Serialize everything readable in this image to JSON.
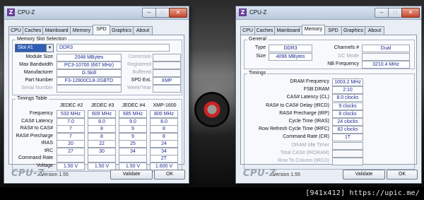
{
  "footer": "[941x412] https://upic.me/",
  "left": {
    "app_icon": "Z",
    "title": "CPU-Z",
    "tabs": [
      "CPU",
      "Caches",
      "Mainboard",
      "Memory",
      "SPD",
      "Graphics",
      "About"
    ],
    "active_tab": "SPD",
    "slot_group_title": "Memory Slot Selection",
    "slot_select": "Slot #1",
    "memory_type": "DDR3",
    "rows": [
      {
        "label": "Module Size",
        "value": "2048 MBytes",
        "right_label": "Correction",
        "right_value": ""
      },
      {
        "label": "Max Bandwidth",
        "value": "PC3-10700 (667 MHz)",
        "right_label": "Registered",
        "right_value": ""
      },
      {
        "label": "Manufacturer",
        "value": "G.Skill",
        "right_label": "Buffered",
        "right_value": ""
      },
      {
        "label": "Part Number",
        "value": "F3-12800CL8-2GBTD",
        "right_label": "SPD Ext.",
        "right_value": "XMP"
      },
      {
        "label": "Serial Number",
        "value": "",
        "right_label": "Week/Year",
        "right_value": ""
      }
    ],
    "timings_group_title": "Timings Table",
    "timings_headers": [
      "JEDEC #2",
      "JEDEC #3",
      "JEDEC #4",
      "XMP-1600"
    ],
    "timings_rows": [
      {
        "label": "Frequency",
        "values": [
          "533 MHz",
          "609 MHz",
          "685 MHz",
          "800 MHz"
        ]
      },
      {
        "label": "CAS# Latency",
        "values": [
          "7.0",
          "8.0",
          "9.0",
          "8.0"
        ]
      },
      {
        "label": "RAS# to CAS#",
        "values": [
          "7",
          "8",
          "9",
          "8"
        ]
      },
      {
        "label": "RAS# Precharge",
        "values": [
          "7",
          "8",
          "9",
          "8"
        ]
      },
      {
        "label": "tRAS",
        "values": [
          "20",
          "22",
          "25",
          "24"
        ]
      },
      {
        "label": "tRC",
        "values": [
          "27",
          "30",
          "34",
          "34"
        ]
      },
      {
        "label": "Command Rate",
        "values": [
          "",
          "",
          "",
          "2T"
        ]
      },
      {
        "label": "Voltage",
        "values": [
          "1.50 V",
          "1.50 V",
          "1.50 V",
          "1.600 V"
        ]
      }
    ],
    "brand": "CPU-Z",
    "version": "Version 1.55",
    "validate_label": "Validate",
    "ok_label": "OK"
  },
  "right": {
    "app_icon": "Z",
    "title": "CPU-Z",
    "tabs": [
      "CPU",
      "Caches",
      "Mainboard",
      "Memory",
      "SPD",
      "Graphics",
      "About"
    ],
    "active_tab": "Memory",
    "general_title": "General",
    "type_label": "Type",
    "type_value": "DDR3",
    "size_label": "Size",
    "size_value": "4096 MBytes",
    "channels_label": "Channels #",
    "channels_value": "Dual",
    "dc_mode_label": "DC Mode",
    "dc_mode_value": "",
    "nb_freq_label": "NB Frequency",
    "nb_freq_value": "3210.4 MHz",
    "timings_title": "Timings",
    "timings": [
      {
        "label": "DRAM Frequency",
        "value": "1003.2 MHz",
        "grey": false
      },
      {
        "label": "FSB:DRAM",
        "value": "2:10",
        "grey": false
      },
      {
        "label": "CAS# Latency (CL)",
        "value": "8.0 clocks",
        "grey": false
      },
      {
        "label": "RAS# to CAS# Delay (tRCD)",
        "value": "9 clocks",
        "grey": false
      },
      {
        "label": "RAS# Precharge (tRP)",
        "value": "8 clocks",
        "grey": false
      },
      {
        "label": "Cycle Time (tRAS)",
        "value": "24 clocks",
        "grey": false
      },
      {
        "label": "Row Refresh Cycle Time (tRFC)",
        "value": "82 clocks",
        "grey": false
      },
      {
        "label": "Command Rate (CR)",
        "value": "1T",
        "grey": false
      },
      {
        "label": "DRAM Idle Timer",
        "value": "",
        "grey": true
      },
      {
        "label": "Total CAS# (tRDRAM)",
        "value": "",
        "grey": true
      },
      {
        "label": "Row To Column (tRCD)",
        "value": "",
        "grey": true
      }
    ],
    "brand": "CPU-Z",
    "version": "Version 1.55",
    "validate_label": "Validate",
    "ok_label": "OK"
  }
}
